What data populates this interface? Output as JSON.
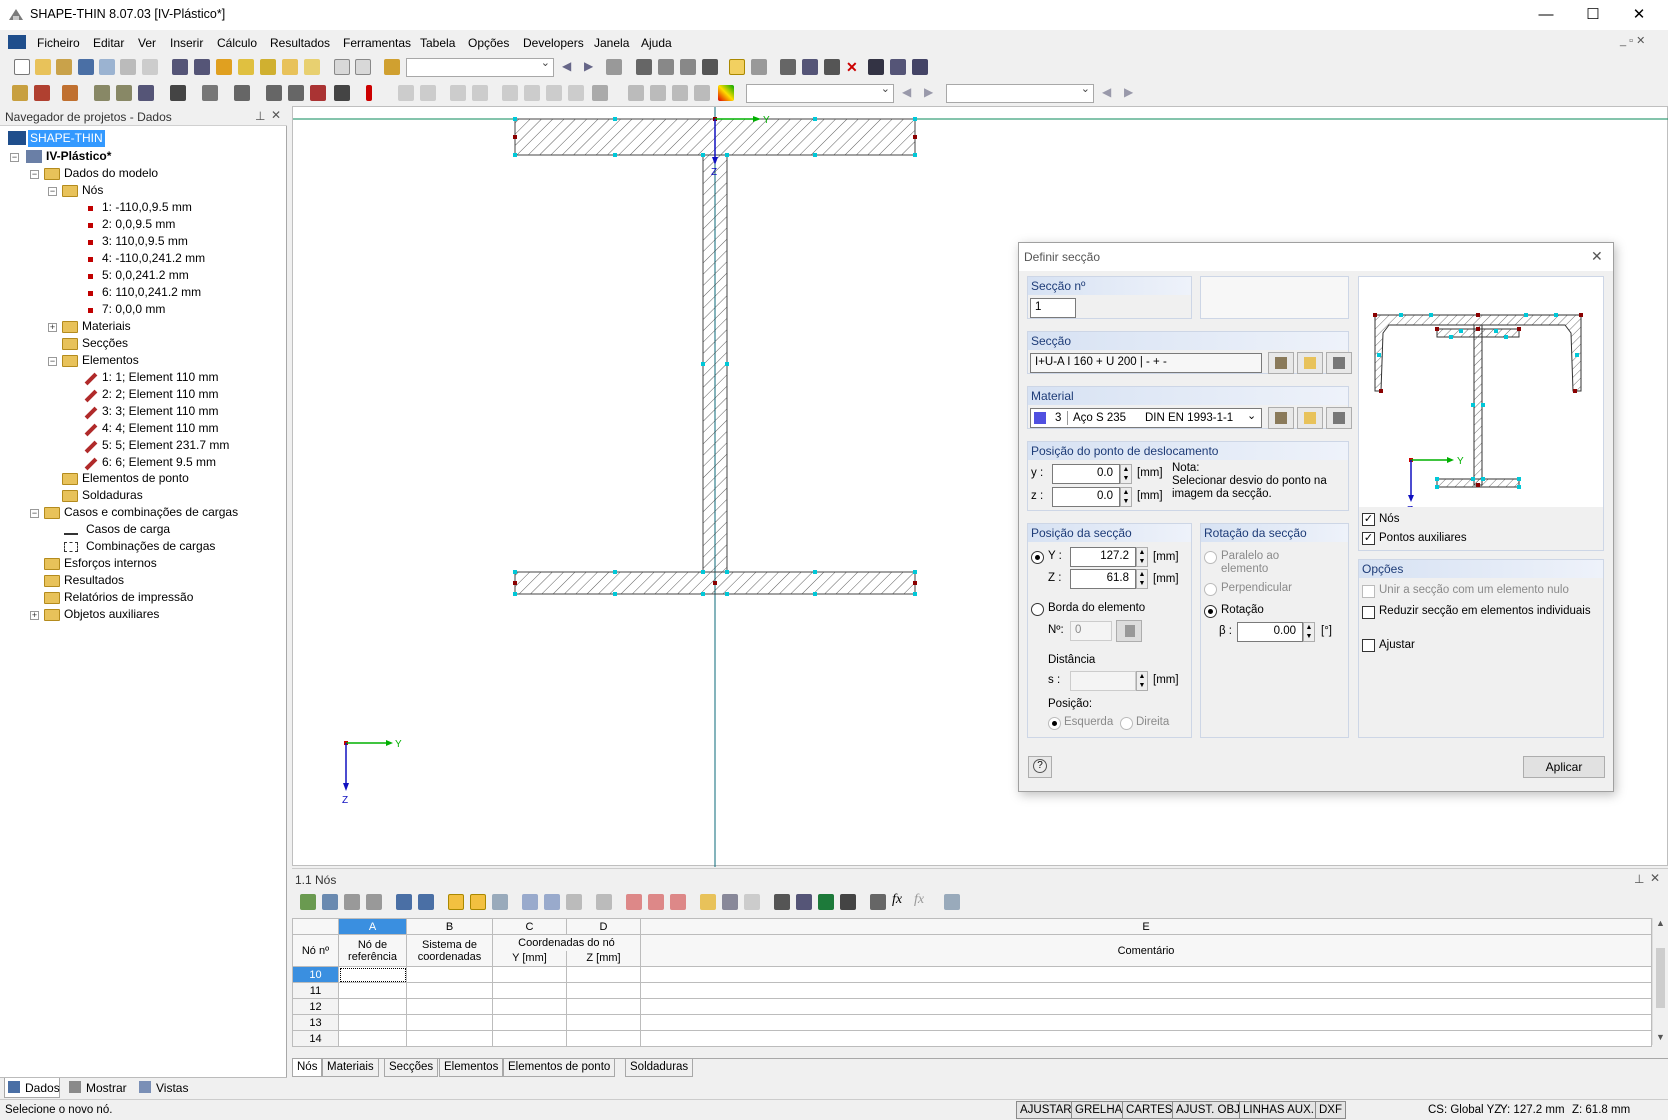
{
  "window": {
    "title": "SHAPE-THIN 8.07.03 [IV-Plástico*]",
    "minimize": "—",
    "maximize": "☐",
    "close": "✕"
  },
  "menu": [
    "Ficheiro",
    "Editar",
    "Ver",
    "Inserir",
    "Cálculo",
    "Resultados",
    "Ferramentas",
    "Tabela",
    "Opções",
    "Developers",
    "Janela",
    "Ajuda"
  ],
  "navigator": {
    "title": "Navegador de projetos - Dados",
    "root": "SHAPE-THIN",
    "project": "IV-Plástico*",
    "model": "Dados do modelo",
    "nodes_label": "Nós",
    "nodes": [
      "1: -110,0,9.5 mm",
      "2: 0,0,9.5 mm",
      "3: 110,0,9.5 mm",
      "4: -110,0,241.2 mm",
      "5: 0,0,241.2 mm",
      "6: 110,0,241.2 mm",
      "7: 0,0,0 mm"
    ],
    "materials": "Materiais",
    "sections": "Secções",
    "elements_label": "Elementos",
    "elements": [
      "1: 1; Element 110 mm",
      "2: 2; Element 110 mm",
      "3: 3; Element 110 mm",
      "4: 4; Element 110 mm",
      "5: 5; Element 231.7 mm",
      "6: 6; Element 9.5 mm"
    ],
    "point_elements": "Elementos de ponto",
    "welds": "Soldaduras",
    "load_cases_group": "Casos e combinações de cargas",
    "load_cases": "Casos de carga",
    "load_combos": "Combinações de cargas",
    "internal_forces": "Esforços internos",
    "results": "Resultados",
    "print_reports": "Relatórios de impressão",
    "aux_objects": "Objetos auxiliares",
    "tabs": [
      "Dados",
      "Mostrar",
      "Vistas"
    ]
  },
  "canvas": {
    "axis_y": "Y",
    "axis_z": "Z"
  },
  "dialog": {
    "title": "Definir secção",
    "section_no_label": "Secção nº",
    "section_no": "1",
    "section_label": "Secção",
    "section_value": "I+U-A I 160 + U 200 | - + -",
    "material_label": "Material",
    "material_no": "3",
    "material_name": "Aço S 235",
    "material_norm": "DIN EN 1993-1-1",
    "offset_label": "Posição do ponto de deslocamento",
    "y_label": "y :",
    "y_value": "0.0",
    "z_label": "z :",
    "z_value": "0.0",
    "mm": "[mm]",
    "note": "Nota:\nSelecionar desvio do ponto na imagem da secção.",
    "position_label": "Posição da secção",
    "Y_label": "Y :",
    "Y_value": "127.2",
    "Z_label": "Z :",
    "Z_value": "61.8",
    "edge_label": "Borda do elemento",
    "no_label": "Nº:",
    "no_value": "0",
    "distance_label": "Distância",
    "s_label": "s :",
    "pos_label": "Posição:",
    "left": "Esquerda",
    "right": "Direita",
    "rotation_label": "Rotação da secção",
    "parallel": "Paralelo ao elemento",
    "perpendicular": "Perpendicular",
    "rotation": "Rotação",
    "beta_label": "β :",
    "beta_value": "0.00",
    "deg": "[°]",
    "nodes_chk": "Nós",
    "aux_points_chk": "Pontos auxiliares",
    "options_label": "Opções",
    "opt1": "Unir a secção com um elemento nulo",
    "opt2": "Reduzir secção em elementos individuais",
    "opt3": "Ajustar",
    "apply": "Aplicar",
    "preview_y": "Y",
    "preview_z": "Z"
  },
  "table": {
    "title": "1.1 Nós",
    "cols": [
      "A",
      "B",
      "C",
      "D",
      "E"
    ],
    "h_no": "Nó nº",
    "h_ref": "Nó de referência",
    "h_sys": "Sistema de coordenadas",
    "h_coords": "Coordenadas do nó",
    "h_y": "Y [mm]",
    "h_z": "Z [mm]",
    "h_comment": "Comentário",
    "rows": [
      "10",
      "11",
      "12",
      "13",
      "14"
    ],
    "tabs": [
      "Nós",
      "Materiais",
      "Secções",
      "Elementos",
      "Elementos de ponto",
      "Soldaduras"
    ]
  },
  "status": {
    "message": "Selecione o novo nó.",
    "buttons": [
      "AJUSTAR",
      "GRELHA",
      "CARTES",
      "AJUST. OBJ.",
      "LINHAS AUX.",
      "DXF"
    ],
    "cs": "CS: Global YZ",
    "y": "Y:  127.2 mm",
    "z": "Z:  61.8 mm"
  }
}
